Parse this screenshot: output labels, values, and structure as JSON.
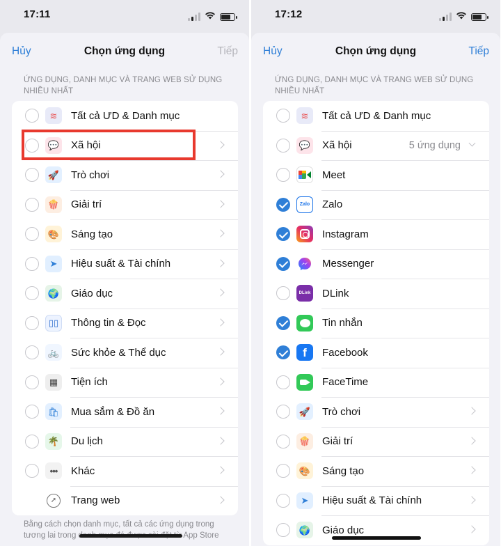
{
  "left": {
    "status": {
      "time": "17:11"
    },
    "nav": {
      "cancel": "Hủy",
      "title": "Chọn ứng dụng",
      "next": "Tiếp"
    },
    "section_header": "ỨNG DỤNG, DANH MỤC VÀ TRANG WEB SỬ DỤNG NHIỀU NHẤT",
    "items": [
      {
        "label": "Tất cả ƯD & Danh mục",
        "icon": "stack-icon",
        "checked": false
      },
      {
        "label": "Xã hội",
        "icon": "social-icon",
        "checked": false
      },
      {
        "label": "Trò chơi",
        "icon": "rocket-icon",
        "checked": false
      },
      {
        "label": "Giải trí",
        "icon": "popcorn-icon",
        "checked": false
      },
      {
        "label": "Sáng tạo",
        "icon": "palette-icon",
        "checked": false
      },
      {
        "label": "Hiệu suất & Tài chính",
        "icon": "paper-plane-icon",
        "checked": false
      },
      {
        "label": "Giáo dục",
        "icon": "globe-icon",
        "checked": false
      },
      {
        "label": "Thông tin & Đọc",
        "icon": "book-icon",
        "checked": false
      },
      {
        "label": "Sức khỏe & Thể dục",
        "icon": "bicycle-icon",
        "checked": false
      },
      {
        "label": "Tiện ích",
        "icon": "calculator-icon",
        "checked": false
      },
      {
        "label": "Mua sắm & Đồ ăn",
        "icon": "shopping-bag-icon",
        "checked": false
      },
      {
        "label": "Du lịch",
        "icon": "palm-tree-icon",
        "checked": false
      },
      {
        "label": "Khác",
        "icon": "more-icon",
        "checked": false
      },
      {
        "label": "Trang web",
        "icon": "compass-icon",
        "checked": false
      }
    ],
    "footer": "Bằng cách chọn danh mục, tất cả các ứng dụng trong tương lai trong danh mục đó được cài đặt từ App Store"
  },
  "right": {
    "status": {
      "time": "17:12"
    },
    "nav": {
      "cancel": "Hủy",
      "title": "Chọn ứng dụng",
      "next": "Tiếp"
    },
    "section_header": "ỨNG DỤNG, DANH MỤC VÀ TRANG WEB SỬ DỤNG NHIỀU NHẤT",
    "items": [
      {
        "label": "Tất cả ƯD & Danh mục",
        "icon": "stack-icon",
        "checked": false
      },
      {
        "label": "Xã hội",
        "icon": "social-icon",
        "checked": false,
        "detail": "5 ứng dụng"
      },
      {
        "label": "Meet",
        "icon": "google-meet-icon",
        "checked": false
      },
      {
        "label": "Zalo",
        "icon": "zalo-icon",
        "checked": true
      },
      {
        "label": "Instagram",
        "icon": "instagram-icon",
        "checked": true
      },
      {
        "label": "Messenger",
        "icon": "messenger-icon",
        "checked": true
      },
      {
        "label": "DLink",
        "icon": "dlink-icon",
        "checked": false
      },
      {
        "label": "Tin nhắn",
        "icon": "messages-icon",
        "checked": true
      },
      {
        "label": "Facebook",
        "icon": "facebook-icon",
        "checked": true
      },
      {
        "label": "FaceTime",
        "icon": "facetime-icon",
        "checked": false
      },
      {
        "label": "Trò chơi",
        "icon": "rocket-icon",
        "checked": false
      },
      {
        "label": "Giải trí",
        "icon": "popcorn-icon",
        "checked": false
      },
      {
        "label": "Sáng tạo",
        "icon": "palette-icon",
        "checked": false
      },
      {
        "label": "Hiệu suất & Tài chính",
        "icon": "paper-plane-icon",
        "checked": false
      },
      {
        "label": "Giáo dục",
        "icon": "globe-icon",
        "checked": false
      }
    ]
  },
  "icon_glyphs": {
    "zalo": "Zalo",
    "dlink": "DLink",
    "facebook": "f"
  },
  "colors": {
    "accent": "#2f7fd7",
    "highlight": "#e8392e",
    "checked": "#2f7fd7"
  }
}
